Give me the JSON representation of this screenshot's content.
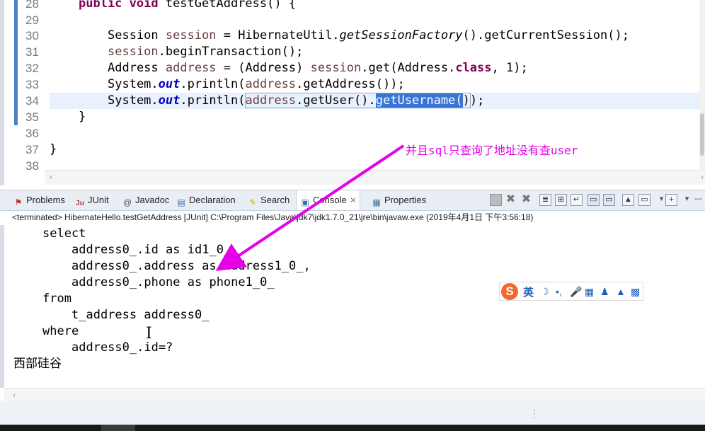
{
  "editor": {
    "line_numbers": [
      "28",
      "29",
      "30",
      "31",
      "32",
      "33",
      "34",
      "35",
      "36",
      "37",
      "38"
    ],
    "lines": {
      "l28": {
        "kw1": "public void",
        "rest": " testGetAddress() {"
      },
      "l30": {
        "p1": "Session ",
        "v1": "session",
        "p2": " = HibernateUtil.",
        "m1": "getSessionFactory",
        "p3": "().getCurrentSession();"
      },
      "l31": {
        "v1": "session",
        "p1": ".beginTransaction();"
      },
      "l32": {
        "p1": "Address ",
        "v1": "address",
        "p2": " = (Address) ",
        "v2": "session",
        "p3": ".get(Address.",
        "kw1": "class",
        "p4": ", 1);"
      },
      "l33": {
        "p1": "System.",
        "f1": "out",
        "p2": ".println(",
        "v1": "address",
        "p3": ".getAddress());"
      },
      "l34": {
        "p1": "System.",
        "f1": "out",
        "p2": ".println(",
        "v1": "address",
        "p3": ".getUser().",
        "sel": "getUsername(",
        "p4": ")",
        "p5": ");"
      },
      "l35": {
        "p1": "}"
      },
      "l37": {
        "p1": "}"
      }
    }
  },
  "tabs": [
    {
      "label": "Problems",
      "icon": "problems-icon"
    },
    {
      "label": "JUnit",
      "icon": "junit-icon"
    },
    {
      "label": "Javadoc",
      "icon": "javadoc-icon"
    },
    {
      "label": "Declaration",
      "icon": "declaration-icon"
    },
    {
      "label": "Search",
      "icon": "search-icon"
    },
    {
      "label": "Console",
      "icon": "console-icon"
    },
    {
      "label": "Properties",
      "icon": "properties-icon"
    }
  ],
  "console": {
    "header": "<terminated> HibernateHello.testGetAddress [JUnit] C:\\Program Files\\Java\\jdk7\\jdk1.7.0_21\\jre\\bin\\javaw.exe (2019年4月1日 下午3:56:18)",
    "lines": [
      "select",
      "address0_.id as id1_0_",
      "address0_.address as address1_0_,",
      "address0_.phone as phone1_0_",
      "from",
      "t_address address0_",
      "where",
      "address0_.id=?",
      "西部硅谷"
    ]
  },
  "annotation": {
    "text": "并且sql只查询了地址没有查user",
    "color": "#e600e6"
  },
  "ime": {
    "logo": "S",
    "lang": "英"
  },
  "colors": {
    "keyword": "#7f0055",
    "variable": "#6a3e3e",
    "field": "#0000c0",
    "selection": "#3875d7"
  }
}
